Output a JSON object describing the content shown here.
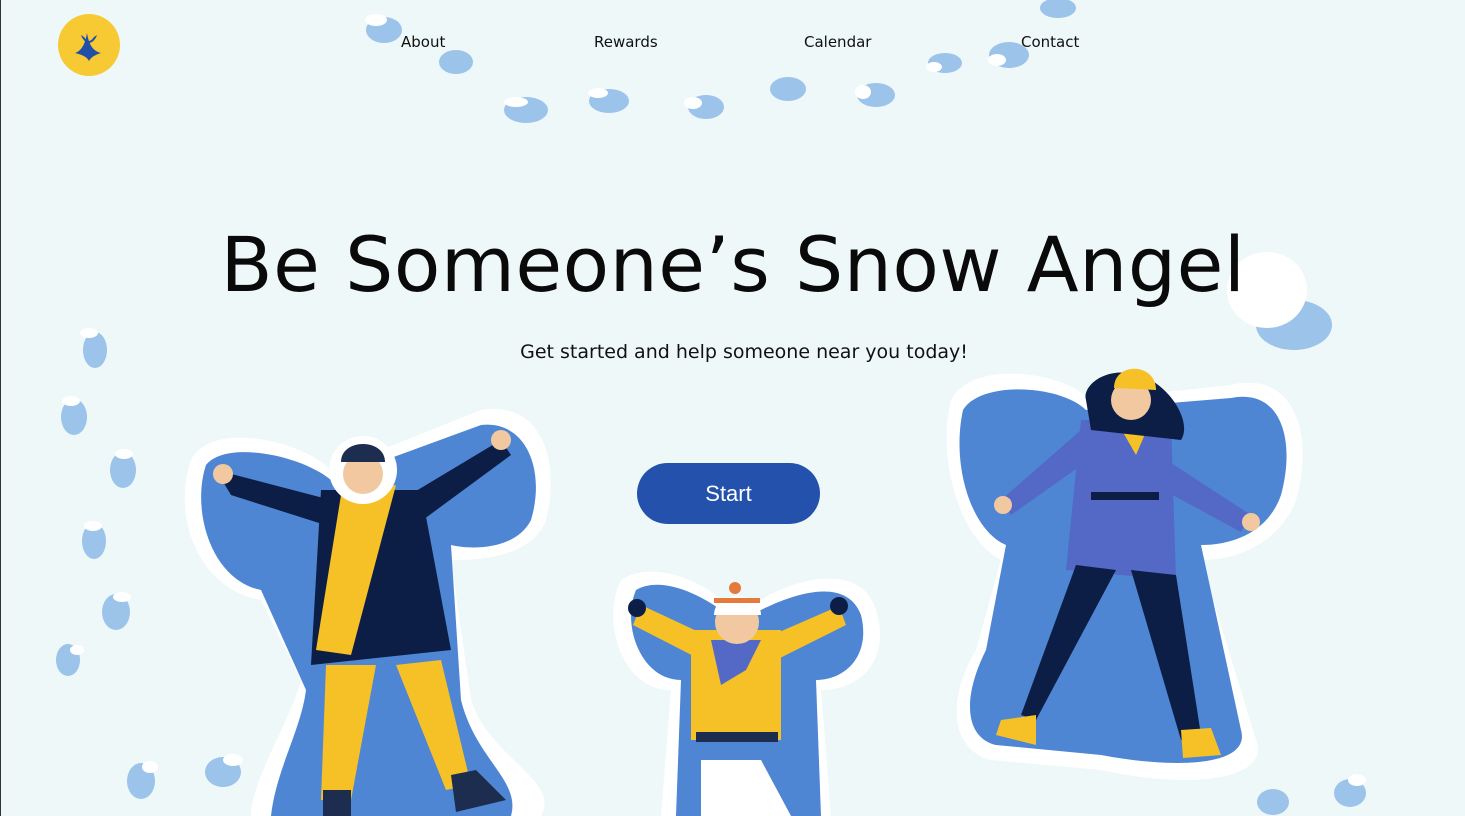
{
  "brand": {
    "logo_icon": "snow-angel-logo-icon",
    "logo_color": "#f7c932",
    "logo_mark_color": "#1f4fa8"
  },
  "nav": [
    {
      "label": "About"
    },
    {
      "label": "Rewards"
    },
    {
      "label": "Calendar"
    },
    {
      "label": "Contact"
    }
  ],
  "hero": {
    "title": "Be Someone’s Snow Angel",
    "subtitle": "Get started and help someone near you today!",
    "cta_label": "Start"
  },
  "colors": {
    "background": "#eef8f9",
    "button": "#2451ac",
    "snow_angel_blue": "#4f86d4",
    "footprint_blue": "#9cc3ea",
    "coat_navy": "#0c1e45",
    "yellow": "#f5c127",
    "coat_purple": "#5468c6"
  },
  "illustration": {
    "figures": [
      "man-snow-angel",
      "child-snow-angel",
      "woman-snow-angel"
    ]
  }
}
